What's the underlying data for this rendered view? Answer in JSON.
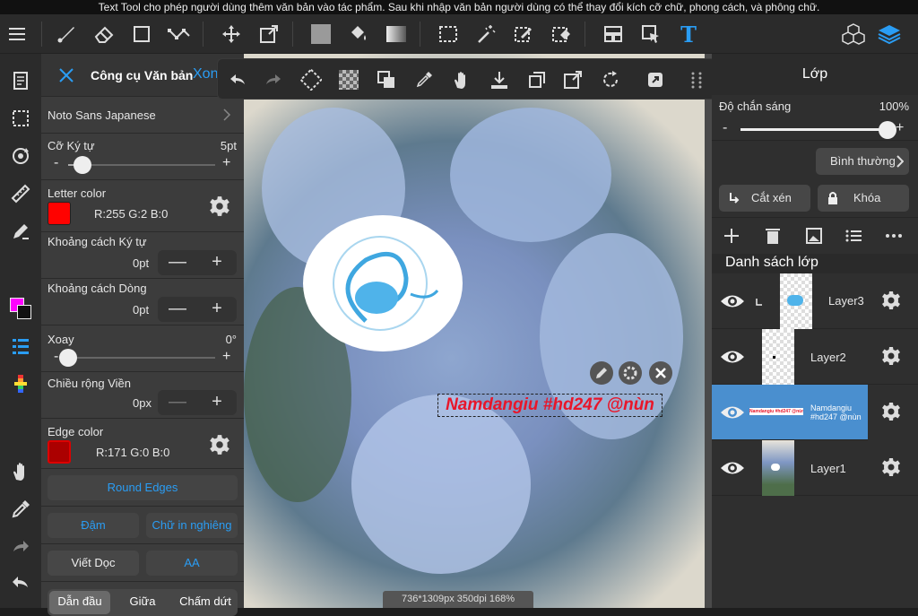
{
  "caption": "Text Tool cho phép người dùng thêm văn bản vào tác phẩm. Sau khi nhập văn bản người dùng có thể thay đổi kích cỡ chữ, phong cách, và phông chữ.",
  "colors": {
    "accent": "#2a9df4",
    "selected_layer": "#4a8fcf",
    "text_red": "#e8162a",
    "panel": "#3a3a3a",
    "toolbar": "#2b2b2b"
  },
  "topbar": {
    "icons": [
      "menu-icon",
      "brush-icon",
      "eraser-icon",
      "rectangle-icon",
      "path-icon",
      "move-icon",
      "transform-icon",
      "fill-color-icon",
      "bucket-icon",
      "gradient-icon",
      "select-rect-icon",
      "magic-wand-icon",
      "select-pen-icon",
      "select-eraser-icon",
      "layout-icon",
      "pointer-select-icon",
      "text-tool-icon",
      "materials-icon",
      "layers-icon"
    ],
    "text_tool_glyph": "T"
  },
  "text_panel": {
    "title": "Công cụ Văn bản",
    "done_label": "Xon",
    "font_name": "Noto Sans Japanese",
    "font_size": {
      "label": "Cỡ Ký tự",
      "value": "5pt",
      "level": 0.1
    },
    "letter_color": {
      "label": "Letter color",
      "value": "R:255 G:2 B:0",
      "swatch": "#ff0200"
    },
    "letter_spacing": {
      "label": "Khoảng cách Ký tự",
      "value": "0pt"
    },
    "line_spacing": {
      "label": "Khoảng cách Dòng",
      "value": "0pt"
    },
    "rotation": {
      "label": "Xoay",
      "value": "0°",
      "level": 0.0
    },
    "border_width": {
      "label": "Chiều rộng Viền",
      "value": "0px"
    },
    "edge_color": {
      "label": "Edge color",
      "value": "R:171 G:0 B:0",
      "swatch": "#ab0000"
    },
    "round_edges": "Round Edges",
    "bold": "Đậm",
    "italic": "Chữ in nghiêng",
    "vertical": "Viết Dọc",
    "aa": "AA",
    "align": [
      "Dẫn đầu",
      "Giữa",
      "Chấm dứt"
    ],
    "minus": "-",
    "plus": "+",
    "stepper_minus": "—",
    "stepper_plus": "+"
  },
  "canvas": {
    "text": "Namdangiu #hd247 @nùn",
    "status": "736*1309px 350dpi 168%"
  },
  "layers_panel": {
    "title": "Lớp",
    "opacity_label": "Độ chắn sáng",
    "opacity_value": "100%",
    "opacity_level": 1.0,
    "blend_mode": "Bình thường",
    "clip_label": "Cắt xén",
    "lock_label": "Khóa",
    "list_title": "Danh sách lớp",
    "minus": "-",
    "plus": "+",
    "layers": [
      {
        "name": "Layer3",
        "selected": false
      },
      {
        "name": "Layer2",
        "selected": false
      },
      {
        "name": "Namdangiu #hd247 @nùn",
        "selected": true
      },
      {
        "name": "Layer1",
        "selected": false
      }
    ]
  }
}
